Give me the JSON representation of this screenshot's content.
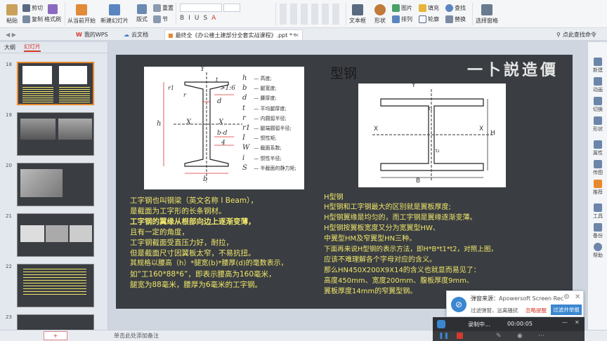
{
  "ribbon": {
    "paste": "粘贴",
    "cut": "剪切",
    "copy": "复制",
    "format_painter": "格式刷",
    "from_current": "从当前开始",
    "new_slide": "新建幻灯片",
    "layout": "版式",
    "reset": "重置",
    "section": "节",
    "textbox": "文本框",
    "shape": "形状",
    "arrange": "排列",
    "picture": "图片",
    "fill": "填充",
    "outline": "轮廓",
    "find": "查找",
    "replace": "替换",
    "select_pane": "选择窗格"
  },
  "tabs": [
    {
      "label": "我的WPS"
    },
    {
      "label": "云文档"
    },
    {
      "label": "最终全《办公楼土建部分全套实战课程》.ppt *"
    }
  ],
  "tabs_right": "点此查找命令",
  "left_pane": {
    "tab_outline": "大纲",
    "tab_slides": "幻灯片",
    "slide_numbers": [
      "18",
      "19",
      "20",
      "21",
      "22",
      "23"
    ]
  },
  "slide": {
    "title": "型钢",
    "brand": "一卜説造價",
    "left_lines": [
      "工字钢也叫钢梁（英文名称 I Beam），",
      "是截面为工字形的长条钢材。",
      "工字钢的翼缘从根部向边上逐渐变薄，",
      "且有一定的角度，",
      "工字钢截面受直压力好，耐拉，",
      "但是截面尺寸因翼板太窄，不易抗扭。",
      "其规格以腰高（h）*腿宽(b)*腰厚(d)的毫数表示，",
      "如“工160*88*6”，即表示腰高为160毫米，",
      "腿宽为88毫米，腰厚为6毫米的工字钢。"
    ],
    "right_lines": [
      "H型钢",
      "H型钢和工字钢最大的区别就是翼板厚度;",
      "H型钢翼缘是均匀的，而工字钢是翼缘逐渐变薄。",
      "H型钢按翼板宽度又分为宽翼型HW、",
      "中翼型HM及窄翼型HN三种。",
      "下面再来说H型钢的表示方法，即H*B*t1*t2，对照上图，",
      "应该不难理解各个字母对应的含义。",
      "那么HN450X200X9X14的含义也就显而易见了：",
      "高度450mm、宽度200mm、腹板厚度9mm、",
      "翼板厚度14mm的窄翼型钢。"
    ],
    "ibeam_legend": [
      {
        "sym": "h",
        "desc": "高度;"
      },
      {
        "sym": "b",
        "desc": "腿宽度;"
      },
      {
        "sym": "d",
        "desc": "腰厚度;"
      },
      {
        "sym": "t",
        "desc": "平均腿厚度;"
      },
      {
        "sym": "r",
        "desc": "内圆弧半径;"
      },
      {
        "sym": "r1",
        "desc": "腿端圆弧半径;"
      },
      {
        "sym": "I",
        "desc": "惯性矩;"
      },
      {
        "sym": "W",
        "desc": "截面系数;"
      },
      {
        "sym": "i",
        "desc": "惯性半径;"
      },
      {
        "sym": "S",
        "desc": "半截面的静力矩;"
      }
    ],
    "ibeam_labels": {
      "y": "Y",
      "x": "X",
      "slope": ">1:6",
      "d": "d",
      "bd": "b-d",
      "four": "4",
      "b": "b",
      "h": "h",
      "r1": "r1",
      "r": "r",
      "t": "t"
    },
    "hbeam_labels": {
      "y": "Y",
      "x": "X",
      "h": "H",
      "b": "B",
      "t1": "t₁",
      "t2": "t₂"
    }
  },
  "right_bar": [
    "新建",
    "动画",
    "切换",
    "形状",
    "属性",
    "传图",
    "推荐",
    "工具",
    "备份",
    "帮助"
  ],
  "statusbar": {
    "note_placeholder": "单击此处添加备注",
    "add": "+"
  },
  "popup": {
    "source_label": "弹窗来源：",
    "source_value": "Apowersoft Screen Rec",
    "filter_text": "过滤弹窗，远离骚扰",
    "ignore": "忽略提醒",
    "report": "过滤并举报"
  },
  "recorder": {
    "status": "录制中...",
    "time": "00:00:05"
  },
  "colors": {
    "slide_bg": "#3a3d42",
    "slide_text": "#f0e76a",
    "accent": "#e8892c",
    "wps_red": "#d23a2a"
  }
}
